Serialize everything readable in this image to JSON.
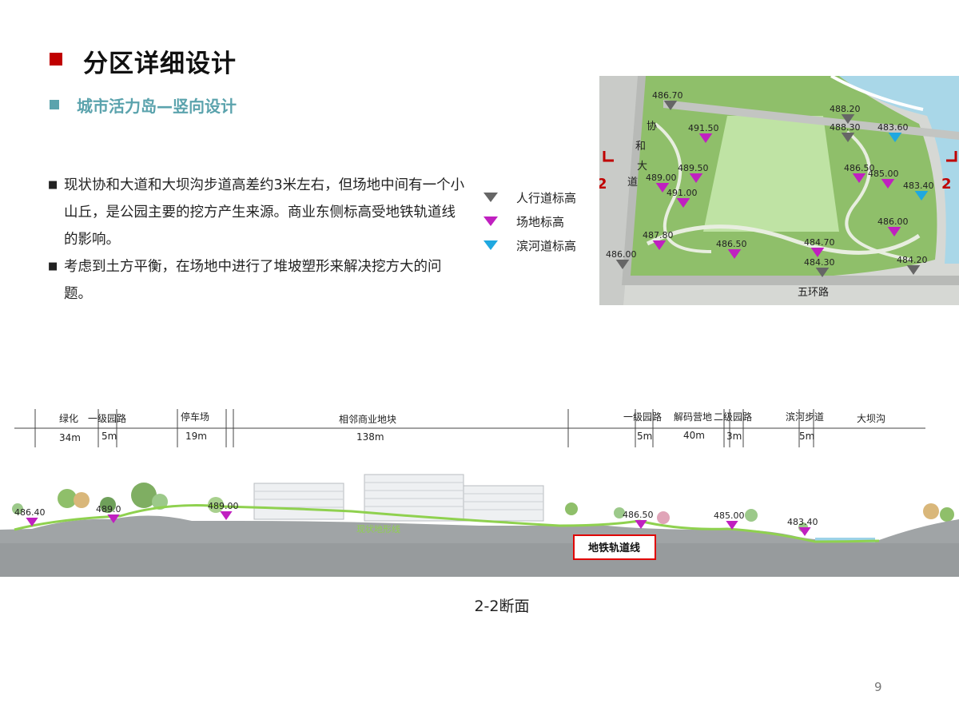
{
  "header": {
    "title": "分区详细设计",
    "subtitle": "城市活力岛—竖向设计",
    "marker_color": "#c00000",
    "subtitle_color": "#5ba3ad"
  },
  "bullets": [
    "现状协和大道和大坝沟步道高差约3米左右，但场地中间有一个小山丘，是公园主要的挖方产生来源。商业东侧标高受地铁轨道线的影响。",
    "考虑到土方平衡，在场地中进行了堆坡塑形来解决挖方大的问题。"
  ],
  "legend": [
    {
      "label": "人行道标高",
      "color": "#666666",
      "icon": "triangle-down-icon"
    },
    {
      "label": "场地标高",
      "color": "#c020c0",
      "icon": "triangle-down-icon"
    },
    {
      "label": "滨河道标高",
      "color": "#1fa8e0",
      "icon": "triangle-down-icon"
    }
  ],
  "plan": {
    "road_xiehe": "协和大道",
    "road_xiehe_chars": [
      "协",
      "和",
      "大",
      "道"
    ],
    "road_wuhuan": "五环路",
    "section_mark": "2",
    "elevations": {
      "sidewalk": [
        "486.70",
        "488.20",
        "488.30",
        "486.00",
        "484.30",
        "484.20"
      ],
      "site": [
        "491.50",
        "489.50",
        "489.00",
        "491.00",
        "486.50",
        "485.00",
        "486.00",
        "487.80",
        "486.50",
        "484.70"
      ],
      "riverside": [
        "483.60",
        "483.40"
      ]
    }
  },
  "section": {
    "caption": "2-2断面",
    "zones": [
      {
        "name": "绿化",
        "width": "34m"
      },
      {
        "name": "一级园路",
        "width": "5m"
      },
      {
        "name": "停车场",
        "width": "19m"
      },
      {
        "name": "相邻商业地块",
        "width": "138m"
      },
      {
        "name": "一级园路",
        "width": "5m"
      },
      {
        "name": "解码营地",
        "width": "40m"
      },
      {
        "name": "二级园路",
        "width": "3m"
      },
      {
        "name": "滨河步道",
        "width": "5m"
      },
      {
        "name": "大坝沟",
        "width": ""
      }
    ],
    "elevations": [
      "486.40",
      "489.0",
      "489.00",
      "486.50",
      "485.00",
      "483.40"
    ],
    "terrain_label": "现状地形线",
    "subway_label": "地铁轨道线",
    "terrain_color": "#8fd14f",
    "subway_box_color": "#e00000"
  },
  "page_number": "9"
}
